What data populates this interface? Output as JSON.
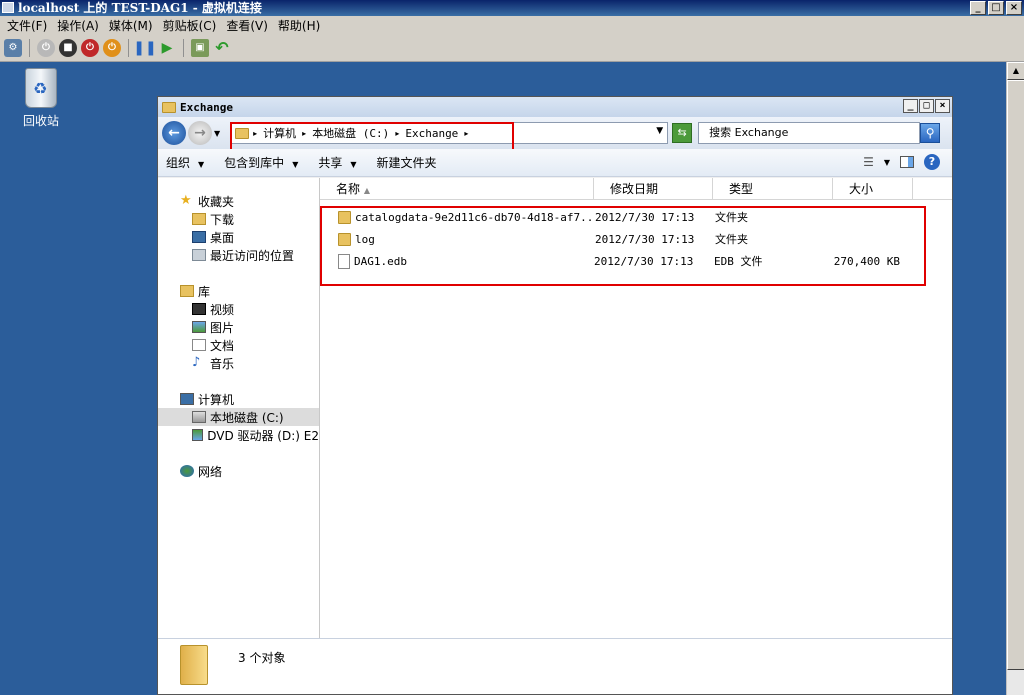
{
  "host": {
    "title": "localhost 上的 TEST-DAG1 - 虚拟机连接",
    "menu": [
      "文件(F)",
      "操作(A)",
      "媒体(M)",
      "剪贴板(C)",
      "查看(V)",
      "帮助(H)"
    ],
    "window_buttons": [
      "_",
      "□",
      "×"
    ]
  },
  "desktop": {
    "recycle_bin_label": "回收站"
  },
  "explorer": {
    "title": "Exchange",
    "address": [
      "计算机",
      "本地磁盘 (C:)",
      "Exchange"
    ],
    "search_placeholder": "搜索 Exchange",
    "commands": [
      "组织",
      "包含到库中",
      "共享",
      "新建文件夹"
    ],
    "nav": {
      "favorites": {
        "header": "收藏夹",
        "items": [
          "下载",
          "桌面",
          "最近访问的位置"
        ]
      },
      "libraries": {
        "header": "库",
        "items": [
          "视频",
          "图片",
          "文档",
          "音乐"
        ]
      },
      "computer": {
        "header": "计算机",
        "items": [
          "本地磁盘 (C:)",
          "DVD 驱动器 (D:) E2"
        ]
      },
      "network": {
        "header": "网络"
      }
    },
    "columns": [
      "名称",
      "修改日期",
      "类型",
      "大小"
    ],
    "files": [
      {
        "name": "catalogdata-9e2d11c6-db70-4d18-af7...",
        "date": "2012/7/30 17:13",
        "type": "文件夹",
        "size": ""
      },
      {
        "name": "log",
        "date": "2012/7/30 17:13",
        "type": "文件夹",
        "size": ""
      },
      {
        "name": "DAG1.edb",
        "date": "2012/7/30 17:13",
        "type": "EDB 文件",
        "size": "270,400 KB"
      }
    ],
    "status": "3 个对象"
  }
}
